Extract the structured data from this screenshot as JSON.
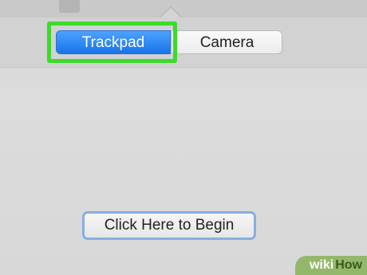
{
  "tabs": {
    "items": [
      {
        "label": "Trackpad",
        "selected": true
      },
      {
        "label": "Camera",
        "selected": false
      }
    ],
    "highlight_color": "#3cdb2b",
    "selected_color": "#1a73e8"
  },
  "begin_button": {
    "label": "Click Here to Begin",
    "focus_ring_color": "#86aee2"
  },
  "watermark": {
    "part1": "wiki",
    "part2": "How"
  }
}
